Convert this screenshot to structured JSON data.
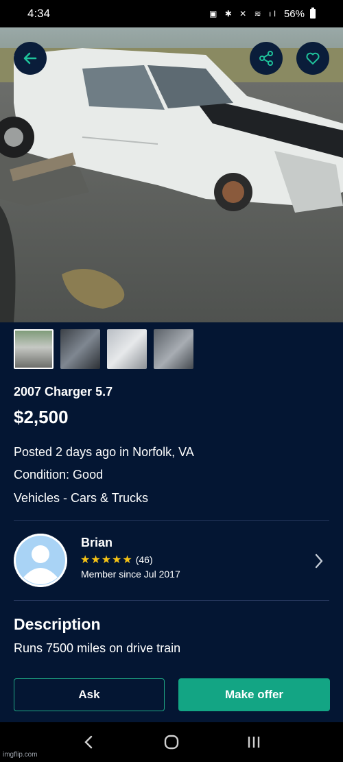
{
  "status_bar": {
    "time": "4:34",
    "icons": "▣ ✱ ✕ ≋ ıl",
    "battery": "56%"
  },
  "listing": {
    "title": "2007 Charger 5.7",
    "price": "$2,500",
    "posted": "Posted 2 days ago in Norfolk, VA",
    "condition": "Condition: Good",
    "category": "Vehicles - Cars & Trucks"
  },
  "seller": {
    "name": "Brian",
    "rating_count": "(46)",
    "stars": 5,
    "member_since": "Member since Jul 2017"
  },
  "description": {
    "heading": "Description",
    "text": "Runs 7500 miles on drive train"
  },
  "actions": {
    "ask_label": "Ask",
    "offer_label": "Make offer"
  },
  "watermark": "imgflip.com",
  "colors": {
    "background": "#041633",
    "accent": "#13a584",
    "star": "#f6c315",
    "icon_teal": "#1fc29b"
  }
}
